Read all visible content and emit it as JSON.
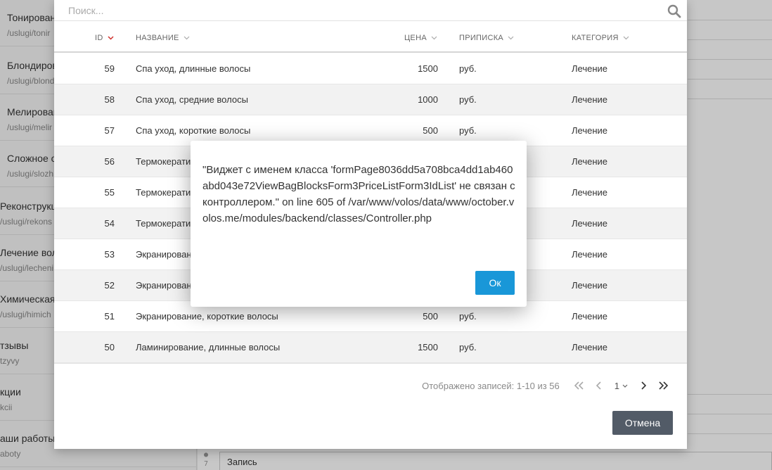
{
  "background": {
    "sidebar": [
      {
        "title": "Тонирован",
        "slug": "/uslugi/tonir",
        "top": 0
      },
      {
        "title": "Блондиров",
        "slug": "/uslugi/blond",
        "top": 0
      },
      {
        "title": "Мелирован",
        "slug": "/uslugi/melir",
        "top": 0
      },
      {
        "title": "Сложное о",
        "slug": "/uslugi/slozh",
        "top": 0
      },
      {
        "title": "Реконструкц",
        "slug": "/uslugi/rekons",
        "top": 0
      },
      {
        "title": "Лечение вол",
        "slug": "/uslugi/lecheni",
        "top": 0
      },
      {
        "title": "Химическая",
        "slug": "/uslugi/himich",
        "top": 0
      },
      {
        "title": "тзывы",
        "slug": "tzyvy",
        "top": 0
      },
      {
        "title": "кции",
        "slug": "kcii",
        "top": 0
      },
      {
        "title": "аши работы",
        "slug": "aboty",
        "top": 0
      }
    ],
    "gutter_number": "7",
    "field_value": "Запись"
  },
  "search": {
    "placeholder": "Поиск..."
  },
  "list": {
    "columns": {
      "id": "ID",
      "name": "НАЗВАНИЕ",
      "price": "ЦЕНА",
      "note": "ПРИПИСКА",
      "category": "КАТЕГОРИЯ"
    },
    "rows": [
      {
        "id": "59",
        "name": "Спа уход, длинные волосы",
        "price": "1500",
        "note": "руб.",
        "category": "Лечение"
      },
      {
        "id": "58",
        "name": "Спа уход, средние волосы",
        "price": "1000",
        "note": "руб.",
        "category": "Лечение"
      },
      {
        "id": "57",
        "name": "Спа уход, короткие волосы",
        "price": "500",
        "note": "руб.",
        "category": "Лечение"
      },
      {
        "id": "56",
        "name": "Термокерати",
        "price": "",
        "note": "",
        "category": "Лечение"
      },
      {
        "id": "55",
        "name": "Термокерати",
        "price": "",
        "note": "",
        "category": "Лечение"
      },
      {
        "id": "54",
        "name": "Термокерати",
        "price": "",
        "note": "",
        "category": "Лечение"
      },
      {
        "id": "53",
        "name": "Экранирован",
        "price": "",
        "note": "",
        "category": "Лечение"
      },
      {
        "id": "52",
        "name": "Экранирован",
        "price": "",
        "note": "",
        "category": "Лечение"
      },
      {
        "id": "51",
        "name": "Экранирование, короткие волосы",
        "price": "500",
        "note": "руб.",
        "category": "Лечение"
      },
      {
        "id": "50",
        "name": "Ламинирование, длинные волосы",
        "price": "1500",
        "note": "руб.",
        "category": "Лечение"
      }
    ]
  },
  "pagination": {
    "info": "Отображено записей: 1-10 из 56",
    "current_page": "1"
  },
  "buttons": {
    "cancel": "Отмена",
    "ok": "Ок"
  },
  "alert": {
    "message": "\"Виджет с именем класса 'formPage8036dd5a708bca4dd1ab460abd043e72ViewBagBlocksForm3PriceListForm3IdList' не связан с контроллером.\" on line 605 of /var/www/volos/data/www/october.volos.me/modules/backend/classes/Controller.php"
  },
  "colors": {
    "accent": "#1997d8",
    "sort_active": "#d0312d",
    "secondary_button": "#525b67"
  }
}
